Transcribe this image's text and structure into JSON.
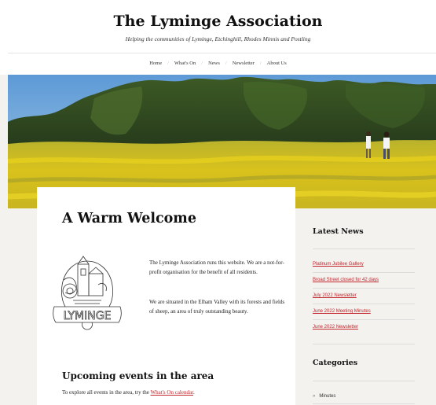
{
  "site": {
    "title": "The Lyminge Association",
    "tagline": "Helping the communities of Lyminge, Etchinghill, Rhodes Minnis and Postling"
  },
  "nav": {
    "items": [
      "Home",
      "What's On",
      "News",
      "Newsletter",
      "About Us"
    ],
    "separator": "/"
  },
  "main": {
    "heading": "A Warm Welcome",
    "logo_text": "LYMINGE",
    "paragraph1": "The Lyminge Association runs this website. We are a not-for-profit organisation for the benefit of all residents.",
    "paragraph2": "We are situated in the Elham Valley with its forests and fields of sheep, an area of truly outstanding beauty.",
    "events_heading": "Upcoming events in the area",
    "events_intro": "To explore all events in the area, try the ",
    "events_link": "What's On calendar",
    "events_end": "."
  },
  "sidebar": {
    "latest_news_heading": "Latest News",
    "news": [
      "Platinum Jubilee Gallery",
      "Broad Street closed for 42 days",
      "July 2022 Newsletter",
      "June 2022 Meeting Minutes",
      "June 2022 Newsletter"
    ],
    "categories_heading": "Categories",
    "categories": [
      "Minutes"
    ],
    "category_icon": "chevron-right-icon"
  },
  "colors": {
    "accent": "#c1272d",
    "page_bg": "#f3f2ef"
  }
}
